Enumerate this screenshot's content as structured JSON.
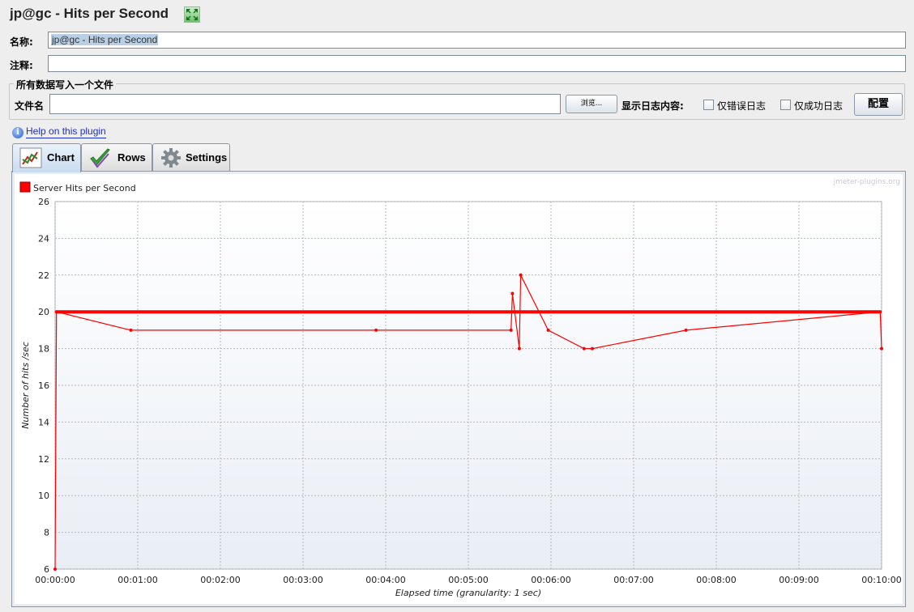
{
  "header": {
    "title": "jp@gc - Hits per Second",
    "expand_icon": "expand-arrows-icon"
  },
  "form": {
    "name_label": "名称:",
    "name_value": "jp@gc - Hits per Second",
    "comment_label": "注释:",
    "comment_value": ""
  },
  "file_group": {
    "title": "所有数据写入一个文件",
    "filename_label": "文件名",
    "filename_value": "",
    "browse_label": "浏览...",
    "log_label": "显示日志内容:",
    "errors_only_label": "仅错误日志",
    "success_only_label": "仅成功日志",
    "config_label": "配置"
  },
  "help": {
    "link_text": "Help on this plugin",
    "icon": "info-icon"
  },
  "tabs": [
    {
      "label": "Chart",
      "icon": "chart-icon",
      "active": true
    },
    {
      "label": "Rows",
      "icon": "checkmark-icon",
      "active": false
    },
    {
      "label": "Settings",
      "icon": "gear-icon",
      "active": false
    }
  ],
  "chart_data": {
    "type": "line",
    "watermark": "jmeter-plugins.org",
    "xlabel": "Elapsed time (granularity: 1 sec)",
    "ylabel": "Number of hits /sec",
    "ylim": [
      6,
      26
    ],
    "y_ticks": [
      6,
      8,
      10,
      12,
      14,
      16,
      18,
      20,
      22,
      24,
      26
    ],
    "xlim": [
      "00:00:00",
      "00:10:00"
    ],
    "x_ticks": [
      "00:00:00",
      "00:01:00",
      "00:02:00",
      "00:03:00",
      "00:04:00",
      "00:05:00",
      "00:06:00",
      "00:07:00",
      "00:08:00",
      "00:09:00",
      "00:10:00"
    ],
    "grid": true,
    "legend_position": "top-left",
    "series": [
      {
        "name": "Server Hits per Second",
        "color": "#ff0000",
        "baseline": 20,
        "points": [
          {
            "t": "00:00:00",
            "v": 6
          },
          {
            "t": "00:00:01",
            "v": 20
          },
          {
            "t": "00:00:55",
            "v": 19
          },
          {
            "t": "00:03:53",
            "v": 19
          },
          {
            "t": "00:05:31",
            "v": 19
          },
          {
            "t": "00:05:32",
            "v": 21
          },
          {
            "t": "00:05:37",
            "v": 18
          },
          {
            "t": "00:05:38",
            "v": 22
          },
          {
            "t": "00:05:58",
            "v": 19
          },
          {
            "t": "00:06:24",
            "v": 18
          },
          {
            "t": "00:06:30",
            "v": 18
          },
          {
            "t": "00:07:38",
            "v": 19
          },
          {
            "t": "00:09:59",
            "v": 20
          },
          {
            "t": "00:10:00",
            "v": 18
          }
        ]
      }
    ]
  }
}
